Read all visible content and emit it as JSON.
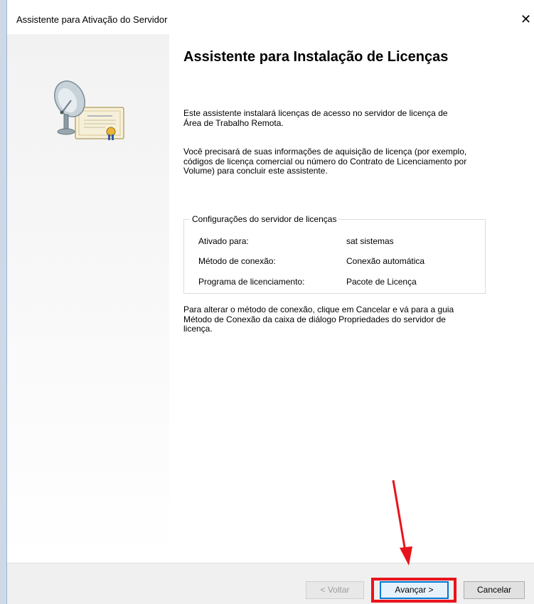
{
  "window": {
    "title": "Assistente para Ativação do Servidor",
    "close_glyph": "✕"
  },
  "main": {
    "heading": "Assistente para Instalação de Licenças",
    "paragraph1": "Este assistente instalará licenças de acesso no servidor de licença de Área de Trabalho Remota.",
    "paragraph2": "Você precisará de suas informações de aquisição de licença (por exemplo, códigos de licença comercial ou número do Contrato de Licenciamento por Volume) para concluir este assistente.",
    "paragraph3": "Para alterar o método de conexão, clique em Cancelar e vá para a guia Método de Conexão da caixa de diálogo Propriedades do servidor de licença."
  },
  "settings": {
    "legend": "Configurações do servidor de licenças",
    "rows": [
      {
        "label": "Ativado para:",
        "value": "sat sistemas"
      },
      {
        "label": "Método de conexão:",
        "value": "Conexão automática"
      },
      {
        "label": "Programa de licenciamento:",
        "value": "Pacote de Licença"
      }
    ]
  },
  "buttons": {
    "back_label": "< Voltar",
    "next_label": "Avançar >",
    "cancel_label": "Cancelar"
  },
  "icons": {
    "wizard": "satellite-certificate-icon",
    "close": "close-icon"
  },
  "colors": {
    "highlight": "#e8141c",
    "focus": "#0078d7"
  }
}
